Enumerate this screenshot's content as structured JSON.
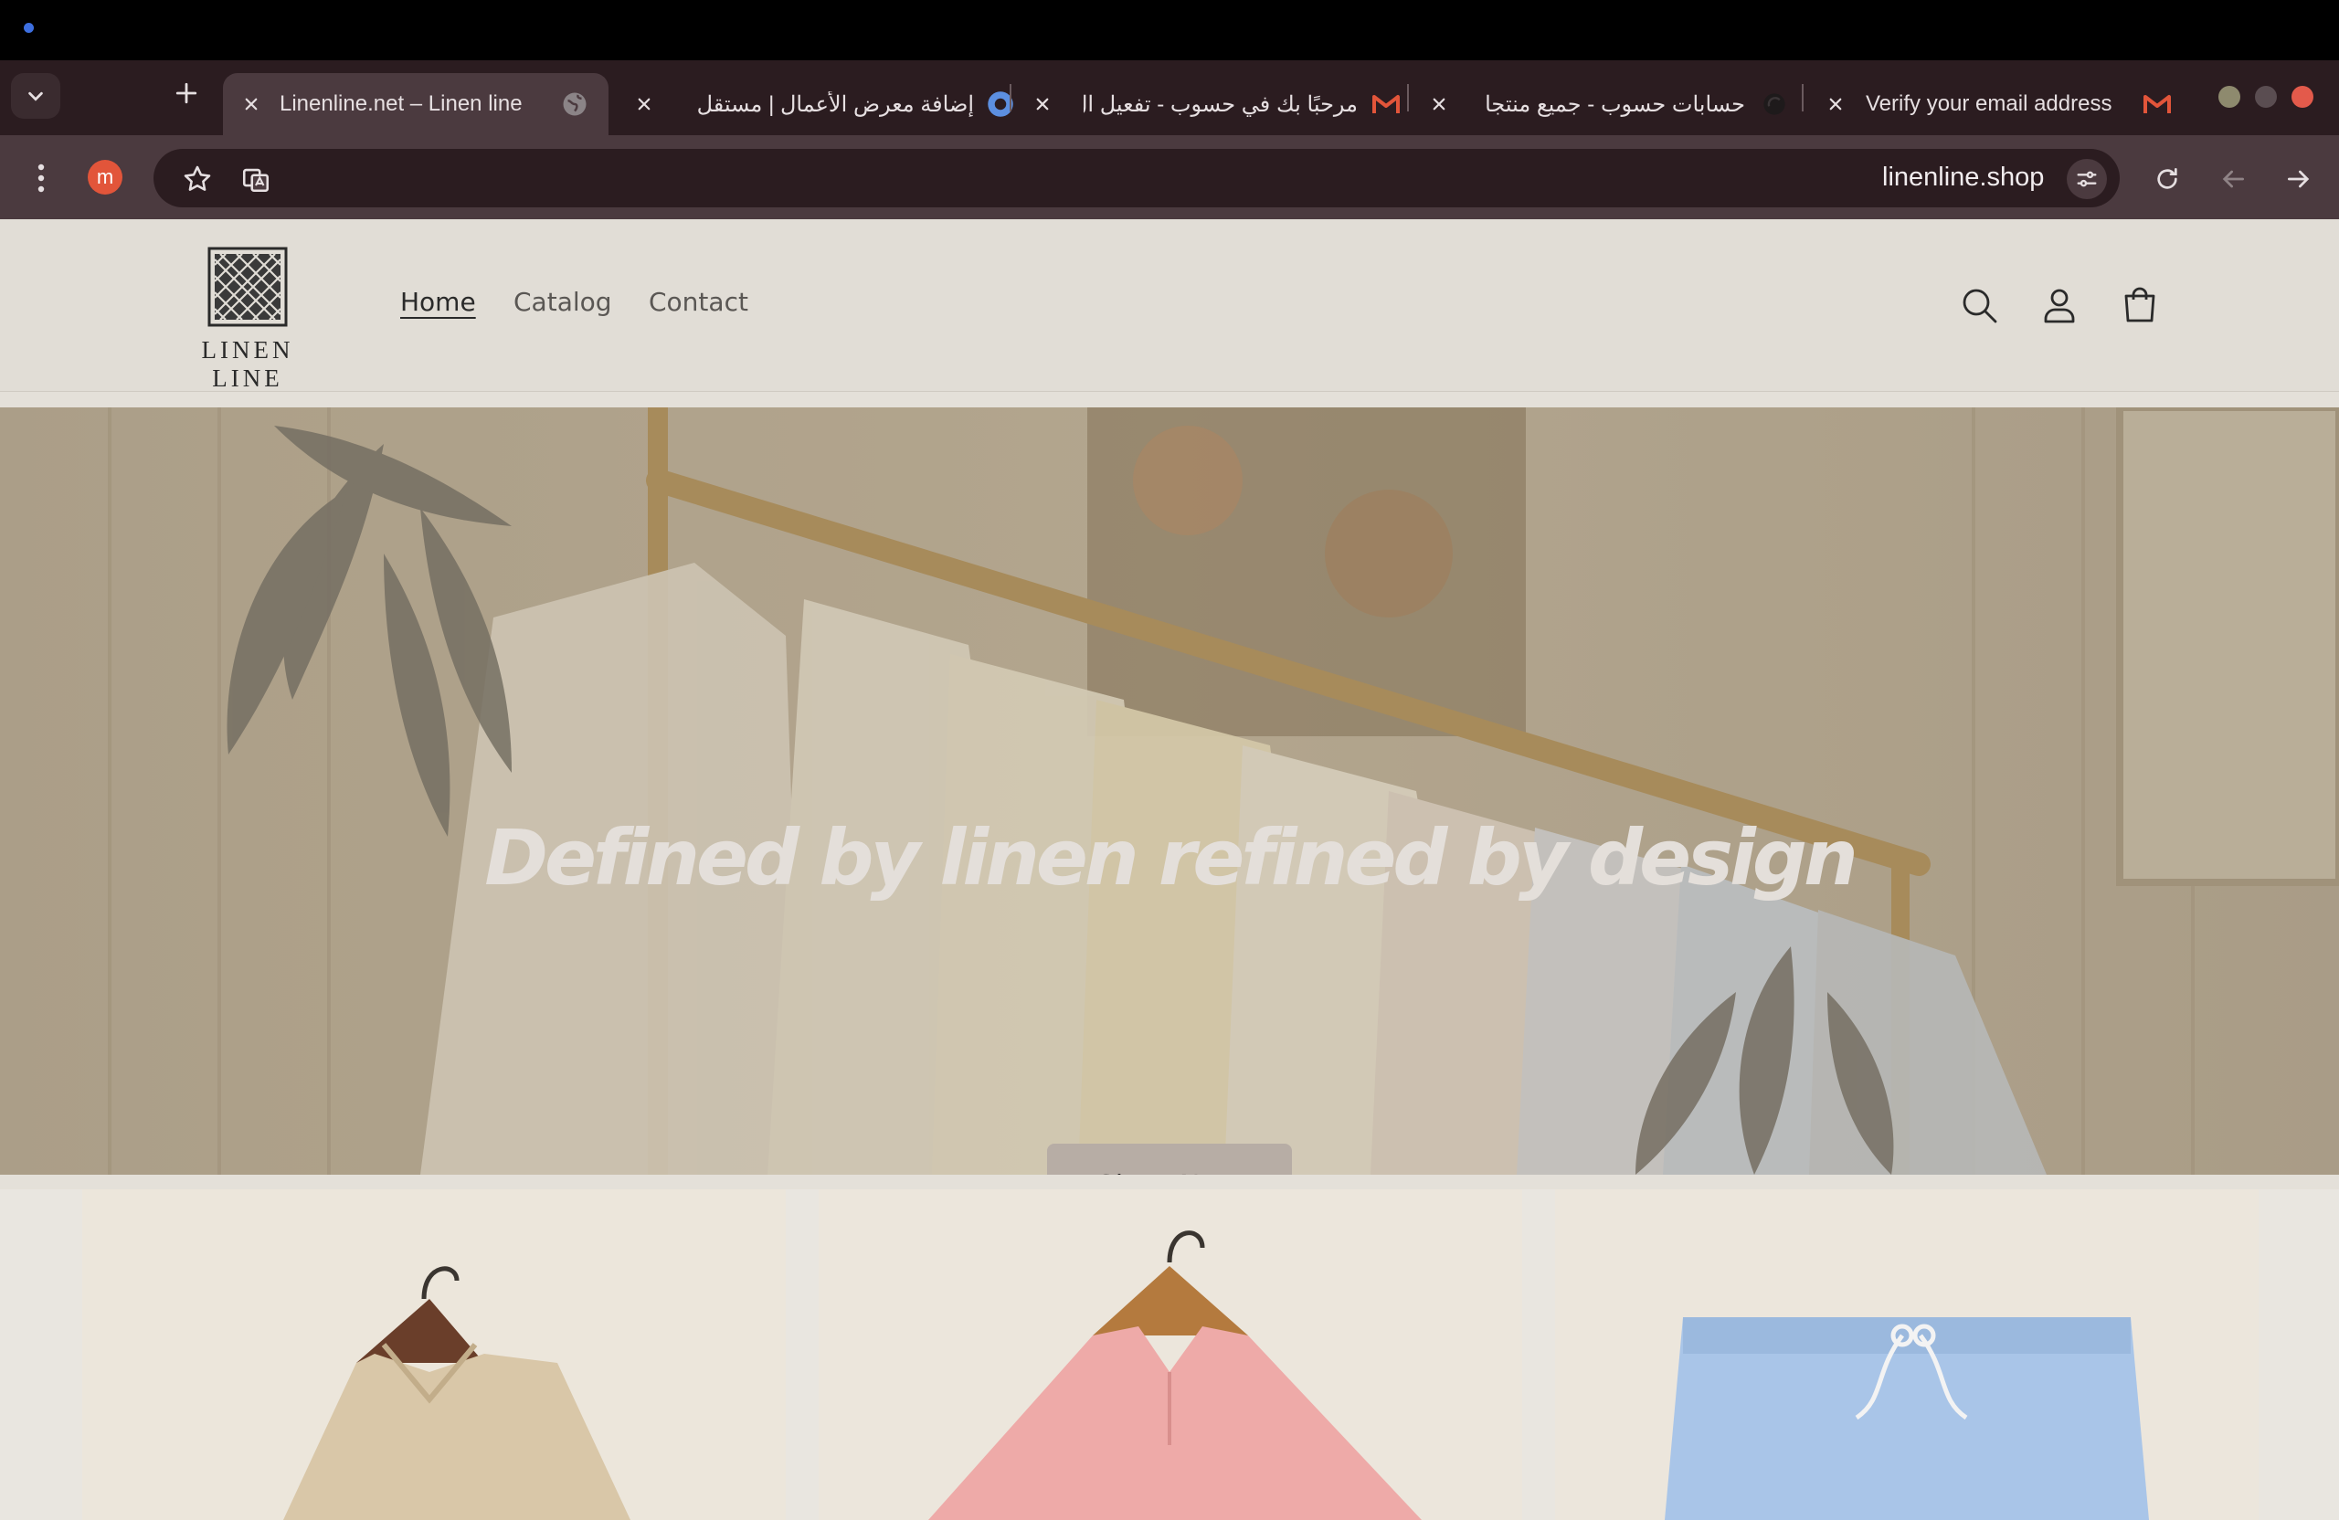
{
  "system": {
    "indicator_color": "#3d6fe0"
  },
  "browser": {
    "tabs": [
      {
        "title": "Linenline.net – Linen line",
        "icon": "globe-icon",
        "active": true
      },
      {
        "title": "إضافة معرض الأعمال | مستقل",
        "icon": "mostaql-icon",
        "active": false
      },
      {
        "title": "مرحبًا بك في حسوب - تفعيل ال",
        "icon": "gmail-icon",
        "active": false
      },
      {
        "title": "حسابات حسوب - جميع منتجا",
        "icon": "hsoub-icon",
        "active": false
      },
      {
        "title": "Verify your email address",
        "icon": "gmail-icon",
        "active": false
      }
    ],
    "profile_initial": "m",
    "url": "linenline.shop",
    "colors": {
      "frame": "#2b1c20",
      "toolbar": "#4b3a3f",
      "profile": "#e2553a"
    }
  },
  "site": {
    "logo_text": "LINEN LINE",
    "nav": [
      {
        "label": "Home",
        "current": true
      },
      {
        "label": "Catalog",
        "current": false
      },
      {
        "label": "Contact",
        "current": false
      }
    ],
    "header_icons": [
      "search-icon",
      "account-icon",
      "cart-icon"
    ],
    "hero": {
      "title": "Defined by linen refined by design",
      "cta": "Shop Now"
    },
    "products": [
      {
        "image": "beige-linen-shirt"
      },
      {
        "image": "pink-linen-shirt"
      },
      {
        "image": "blue-linen-shorts"
      }
    ]
  }
}
